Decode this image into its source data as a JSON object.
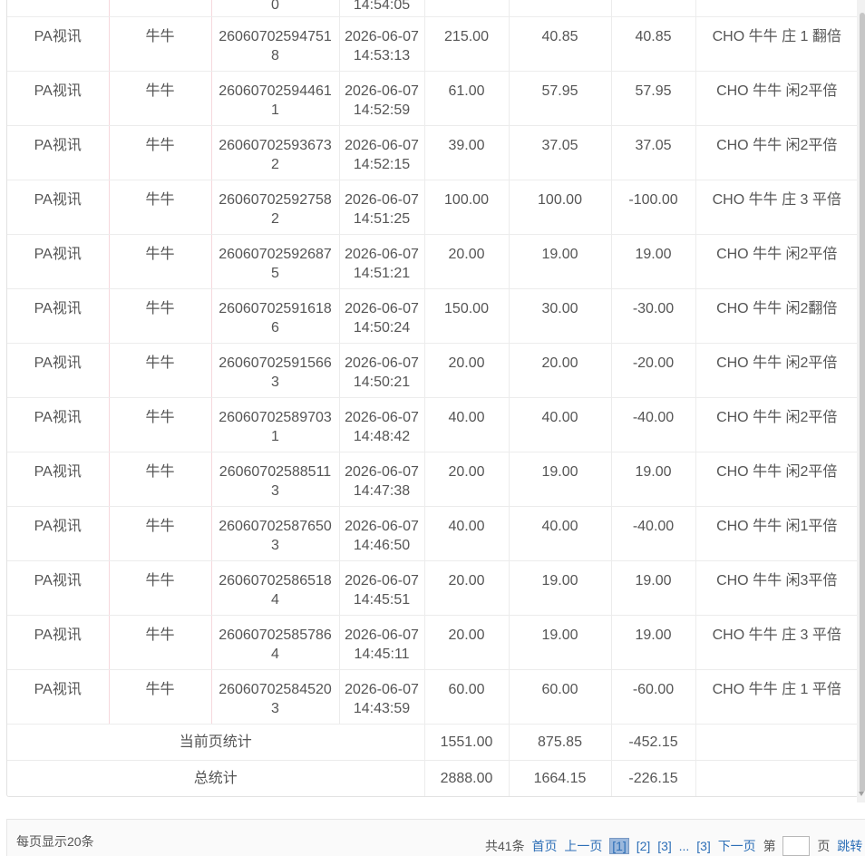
{
  "table": {
    "top_partial": {
      "id_tail": "0",
      "time": "14:54:05"
    },
    "rows": [
      {
        "platform": "PA视讯",
        "game": "牛牛",
        "id_line1": "26060702594751",
        "id_line2": "8",
        "date": "2026-06-07",
        "time": "14:53:13",
        "bet": "215.00",
        "valid": "40.85",
        "payout": "40.85",
        "detail": "CHO 牛牛 庄 1 翻倍"
      },
      {
        "platform": "PA视讯",
        "game": "牛牛",
        "id_line1": "26060702594461",
        "id_line2": "1",
        "date": "2026-06-07",
        "time": "14:52:59",
        "bet": "61.00",
        "valid": "57.95",
        "payout": "57.95",
        "detail": "CHO 牛牛 闲2平倍"
      },
      {
        "platform": "PA视讯",
        "game": "牛牛",
        "id_line1": "26060702593673",
        "id_line2": "2",
        "date": "2026-06-07",
        "time": "14:52:15",
        "bet": "39.00",
        "valid": "37.05",
        "payout": "37.05",
        "detail": "CHO 牛牛 闲2平倍"
      },
      {
        "platform": "PA视讯",
        "game": "牛牛",
        "id_line1": "26060702592758",
        "id_line2": "2",
        "date": "2026-06-07",
        "time": "14:51:25",
        "bet": "100.00",
        "valid": "100.00",
        "payout": "-100.00",
        "detail": "CHO 牛牛 庄 3 平倍"
      },
      {
        "platform": "PA视讯",
        "game": "牛牛",
        "id_line1": "26060702592687",
        "id_line2": "5",
        "date": "2026-06-07",
        "time": "14:51:21",
        "bet": "20.00",
        "valid": "19.00",
        "payout": "19.00",
        "detail": "CHO 牛牛 闲2平倍"
      },
      {
        "platform": "PA视讯",
        "game": "牛牛",
        "id_line1": "26060702591618",
        "id_line2": "6",
        "date": "2026-06-07",
        "time": "14:50:24",
        "bet": "150.00",
        "valid": "30.00",
        "payout": "-30.00",
        "detail": "CHO 牛牛 闲2翻倍"
      },
      {
        "platform": "PA视讯",
        "game": "牛牛",
        "id_line1": "26060702591566",
        "id_line2": "3",
        "date": "2026-06-07",
        "time": "14:50:21",
        "bet": "20.00",
        "valid": "20.00",
        "payout": "-20.00",
        "detail": "CHO 牛牛 闲2平倍"
      },
      {
        "platform": "PA视讯",
        "game": "牛牛",
        "id_line1": "26060702589703",
        "id_line2": "1",
        "date": "2026-06-07",
        "time": "14:48:42",
        "bet": "40.00",
        "valid": "40.00",
        "payout": "-40.00",
        "detail": "CHO 牛牛 闲2平倍"
      },
      {
        "platform": "PA视讯",
        "game": "牛牛",
        "id_line1": "26060702588511",
        "id_line2": "3",
        "date": "2026-06-07",
        "time": "14:47:38",
        "bet": "20.00",
        "valid": "19.00",
        "payout": "19.00",
        "detail": "CHO 牛牛 闲2平倍"
      },
      {
        "platform": "PA视讯",
        "game": "牛牛",
        "id_line1": "26060702587650",
        "id_line2": "3",
        "date": "2026-06-07",
        "time": "14:46:50",
        "bet": "40.00",
        "valid": "40.00",
        "payout": "-40.00",
        "detail": "CHO 牛牛 闲1平倍"
      },
      {
        "platform": "PA视讯",
        "game": "牛牛",
        "id_line1": "26060702586518",
        "id_line2": "4",
        "date": "2026-06-07",
        "time": "14:45:51",
        "bet": "20.00",
        "valid": "19.00",
        "payout": "19.00",
        "detail": "CHO 牛牛 闲3平倍"
      },
      {
        "platform": "PA视讯",
        "game": "牛牛",
        "id_line1": "26060702585786",
        "id_line2": "4",
        "date": "2026-06-07",
        "time": "14:45:11",
        "bet": "20.00",
        "valid": "19.00",
        "payout": "19.00",
        "detail": "CHO 牛牛 庄 3 平倍"
      },
      {
        "platform": "PA视讯",
        "game": "牛牛",
        "id_line1": "26060702584520",
        "id_line2": "3",
        "date": "2026-06-07",
        "time": "14:43:59",
        "bet": "60.00",
        "valid": "60.00",
        "payout": "-60.00",
        "detail": "CHO 牛牛 庄 1 平倍"
      }
    ],
    "page_stats": {
      "label": "当前页统计",
      "bet": "1551.00",
      "valid": "875.85",
      "payout": "-452.15"
    },
    "total_stats": {
      "label": "总统计",
      "bet": "2888.00",
      "valid": "1664.15",
      "payout": "-226.15"
    }
  },
  "footer": {
    "per_page": "每页显示20条",
    "total": "共41条",
    "first": "首页",
    "prev": "上一页",
    "pages": [
      "[1]",
      "[2]",
      "[3]",
      "...",
      "[3]"
    ],
    "next": "下一页",
    "goto_prefix": "第",
    "goto_suffix": "页",
    "jump": "跳转"
  }
}
